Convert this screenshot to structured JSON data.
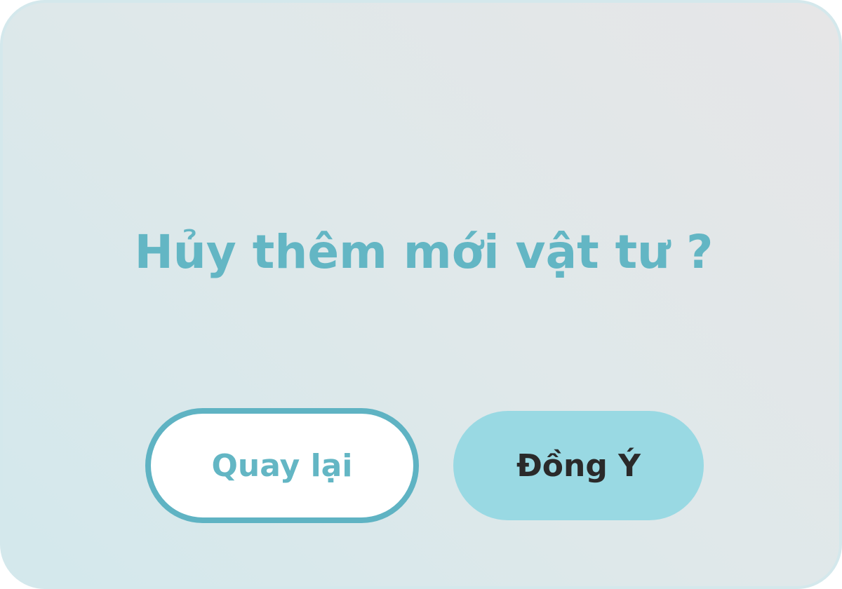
{
  "dialog": {
    "title": "Hủy thêm mới vật tư ?",
    "back_label": "Quay lại",
    "confirm_label": "Đồng Ý"
  },
  "colors": {
    "accent": "#63b6c4",
    "back_border": "#5fb3c3",
    "confirm_bg": "#99d9e3",
    "confirm_text": "#2a2a2a"
  }
}
